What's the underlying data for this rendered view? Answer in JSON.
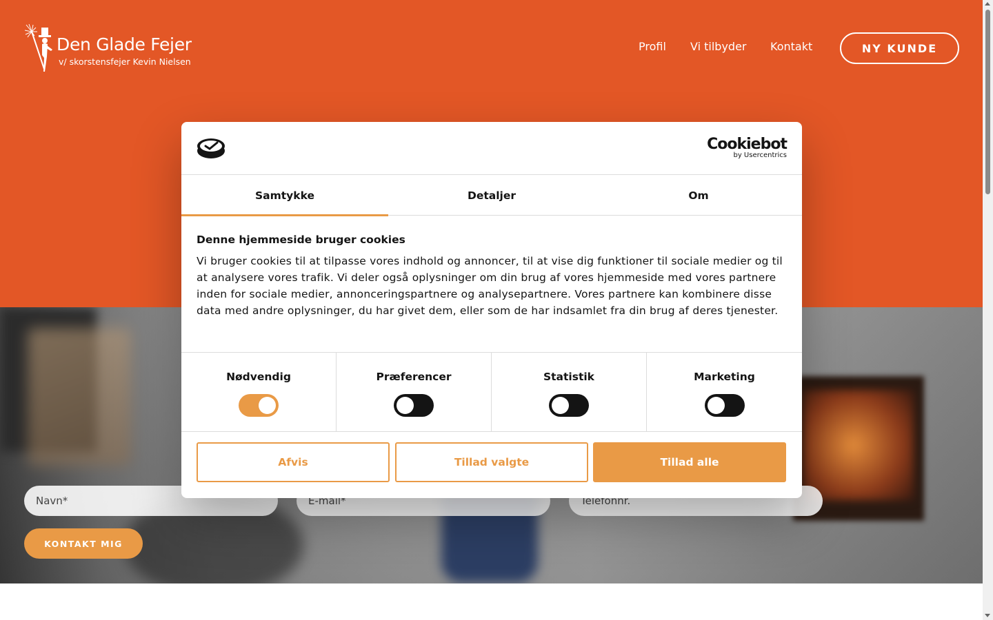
{
  "header": {
    "logo_title": "Den Glade Fejer",
    "logo_subtitle": "v/ skorstensfejer Kevin Nielsen",
    "nav": [
      "Profil",
      "Vi tilbyder",
      "Kontakt"
    ],
    "cta_label": "NY KUNDE",
    "brand_color": "#e35726"
  },
  "form": {
    "name_placeholder": "Navn*",
    "email_placeholder": "E-mail*",
    "phone_placeholder": "Telefonnr.",
    "submit_label": "KONTAKT MIG",
    "accent_color": "#e99a46"
  },
  "cookie_dialog": {
    "brand_name": "Cookiebot",
    "brand_sub": "by Usercentrics",
    "tabs": [
      "Samtykke",
      "Detaljer",
      "Om"
    ],
    "active_tab": "Samtykke",
    "title": "Denne hjemmeside bruger cookies",
    "text": "Vi bruger cookies til at tilpasse vores indhold og annoncer, til at vise dig funktioner til sociale medier og til at analysere vores trafik. Vi deler også oplysninger om din brug af vores hjemmeside med vores partnere inden for sociale medier, annonceringspartnere og analysepartnere. Vores partnere kan kombinere disse data med andre oplysninger, du har givet dem, eller som de har indsamlet fra din brug af deres tjenester.",
    "categories": [
      {
        "label": "Nødvendig",
        "enabled": true
      },
      {
        "label": "Præferencer",
        "enabled": false
      },
      {
        "label": "Statistik",
        "enabled": false
      },
      {
        "label": "Marketing",
        "enabled": false
      }
    ],
    "buttons": {
      "reject": "Afvis",
      "allow_selected": "Tillad valgte",
      "allow_all": "Tillad alle"
    },
    "accent_color": "#e99a46"
  }
}
